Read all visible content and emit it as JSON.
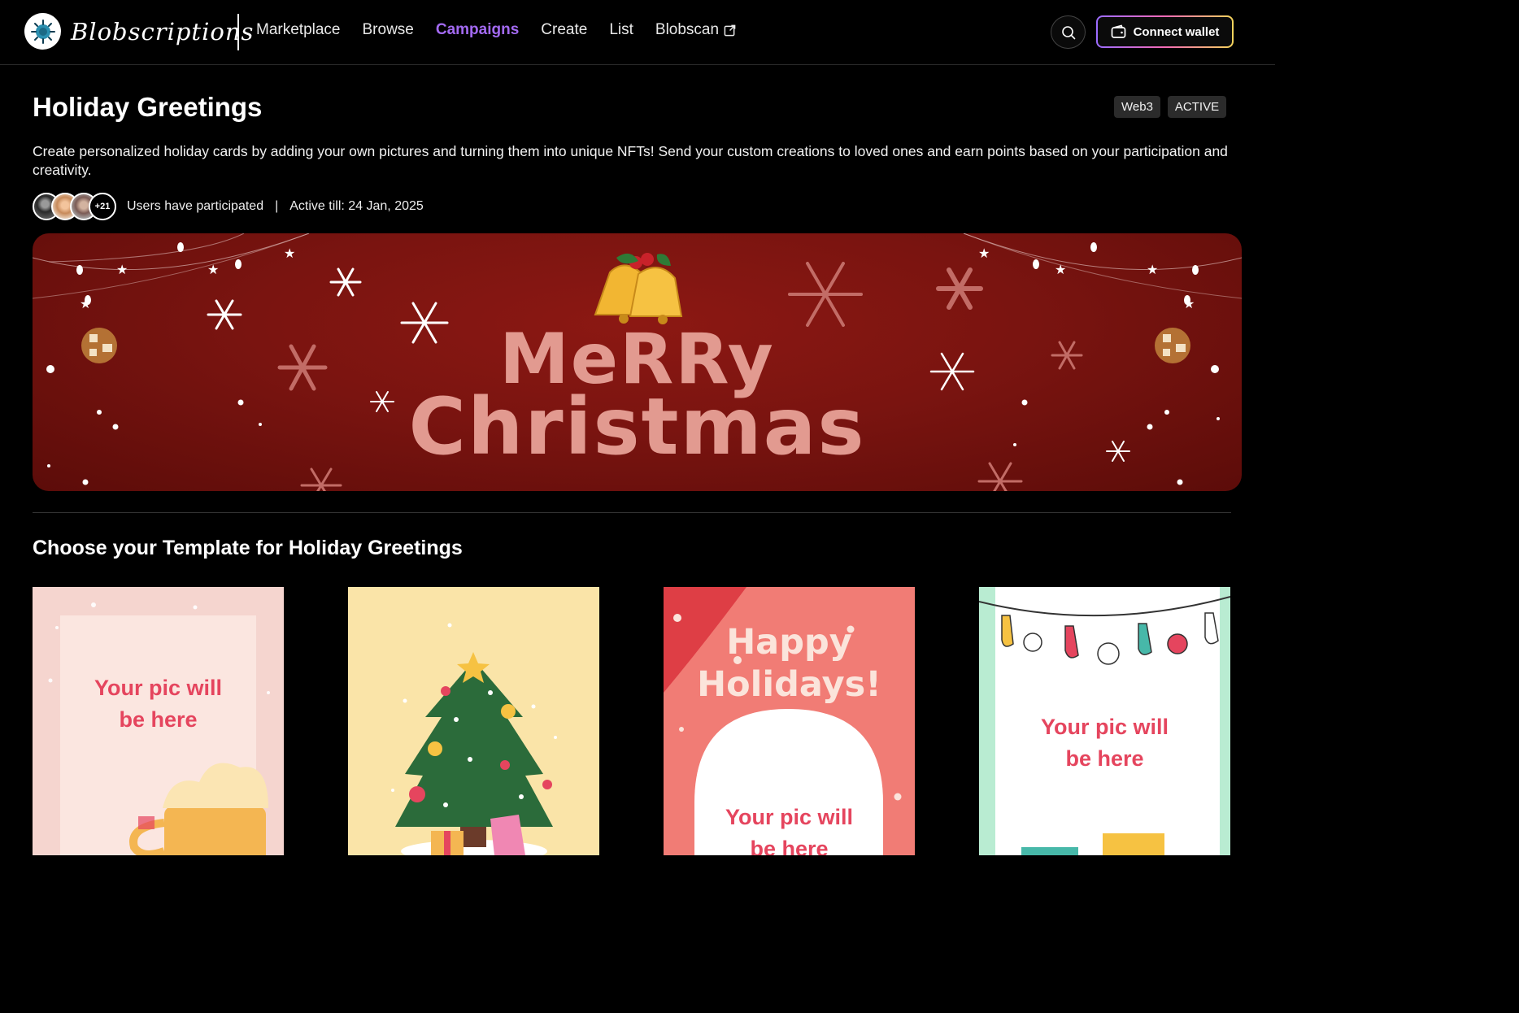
{
  "header": {
    "brand": "Blobscriptions",
    "nav": [
      "Marketplace",
      "Browse",
      "Campaigns",
      "Create",
      "List",
      "Blobscan"
    ],
    "active_nav": "Campaigns",
    "connect_wallet": "Connect wallet"
  },
  "campaign": {
    "title": "Holiday Greetings",
    "badges": [
      "Web3",
      "ACTIVE"
    ],
    "description": "Create personalized holiday cards by adding your own pictures and turning them into unique NFTs! Send your custom creations to loved ones and earn points based on your participation and creativity.",
    "participants_count": "+21",
    "participants_label": "Users have participated",
    "separator": "|",
    "active_till": "Active till: 24 Jan, 2025"
  },
  "banner": {
    "line1": "MeRRy",
    "line2": "Christmas"
  },
  "templates": {
    "section_title": "Choose your Template for Holiday Greetings",
    "cards": [
      {
        "text_line1": "Your pic will",
        "text_line2": "be here"
      },
      {
        "text_line1": "",
        "text_line2": ""
      },
      {
        "heading1": "Happy",
        "heading2": "Holidays!",
        "text_line1": "Your pic will",
        "text_line2": "be here"
      },
      {
        "text_line1": "Your pic will",
        "text_line2": "be here"
      }
    ]
  },
  "colors": {
    "accent": "#a36af2",
    "card_text": "#e5455e",
    "banner_text": "#e29a90"
  }
}
